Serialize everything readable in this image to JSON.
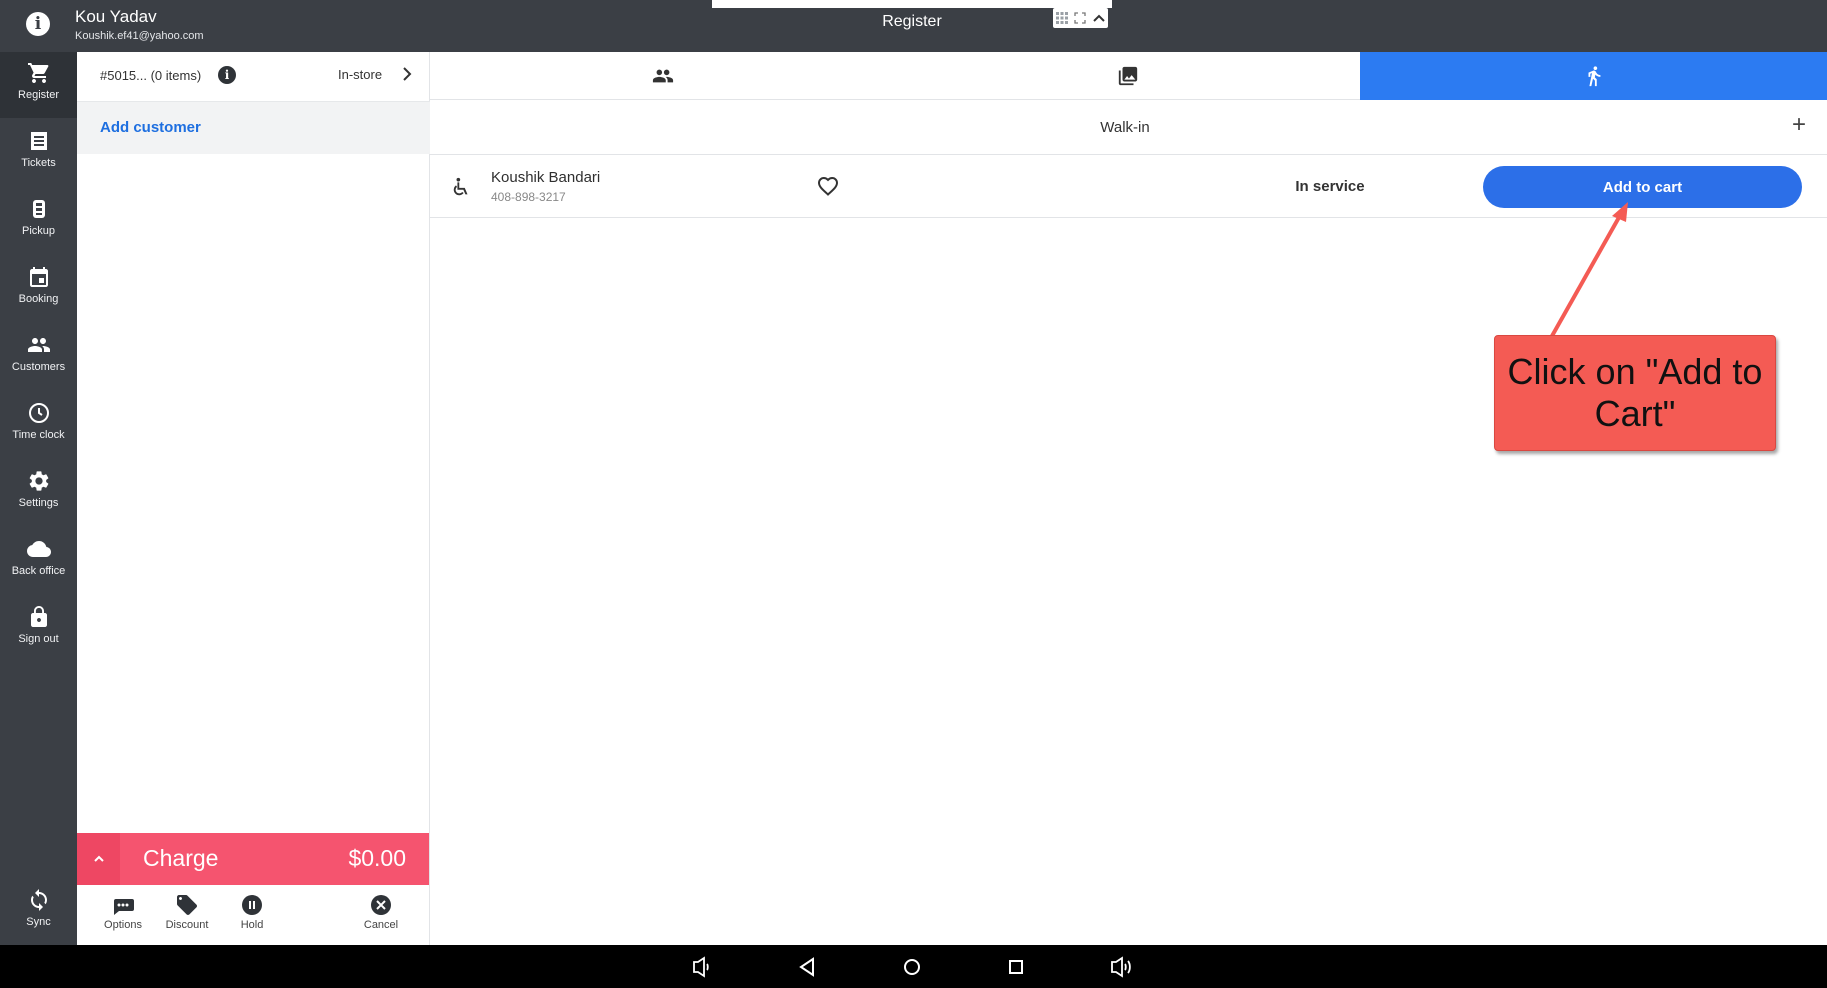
{
  "topbar": {
    "user_name": "Kou Yadav",
    "user_email": "Koushik.ef41@yahoo.com",
    "title": "Register"
  },
  "sidebar": {
    "items": [
      {
        "label": "Register",
        "icon": "cart-icon",
        "active": true
      },
      {
        "label": "Tickets",
        "icon": "receipt-icon"
      },
      {
        "label": "Pickup",
        "icon": "pickup-icon"
      },
      {
        "label": "Booking",
        "icon": "calendar-icon"
      },
      {
        "label": "Customers",
        "icon": "people-icon"
      },
      {
        "label": "Time clock",
        "icon": "clock-icon"
      },
      {
        "label": "Settings",
        "icon": "gear-icon"
      },
      {
        "label": "Back office",
        "icon": "cloud-icon"
      },
      {
        "label": "Sign out",
        "icon": "lock-icon"
      }
    ],
    "sync_label": "Sync"
  },
  "cart": {
    "ticket": "#5015... (0 items)",
    "order_type": "In-store",
    "add_customer": "Add customer",
    "charge_label": "Charge",
    "charge_amount": "$0.00",
    "actions": {
      "options": "Options",
      "discount": "Discount",
      "hold": "Hold",
      "cancel": "Cancel"
    }
  },
  "main": {
    "tabs": [
      {
        "icon": "people-icon"
      },
      {
        "icon": "gallery-icon"
      },
      {
        "icon": "walk-icon",
        "active": true
      }
    ],
    "walkin_title": "Walk-in",
    "walkin_add": "+",
    "rows": [
      {
        "name": "Koushik Bandari",
        "phone": "408-898-3217",
        "status": "In service",
        "button": "Add to cart"
      }
    ]
  },
  "annotation": {
    "text": "Click on \"Add to Cart\"",
    "color": "#f45b54"
  },
  "colors": {
    "accent": "#2c7bf2",
    "charge": "#f5546f",
    "sidebar": "#3b3f45"
  }
}
